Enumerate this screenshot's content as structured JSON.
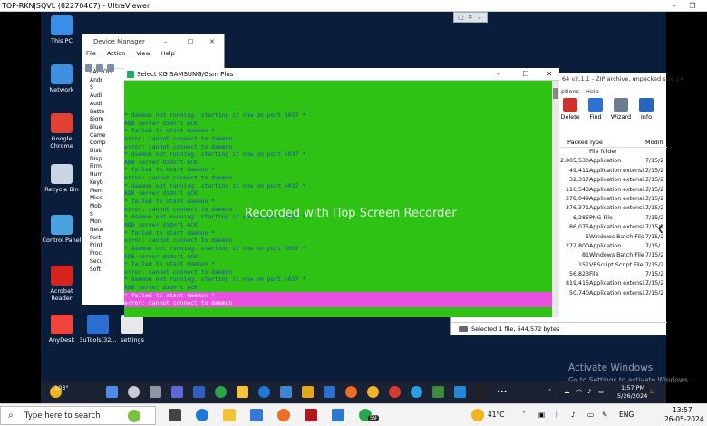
{
  "ultraviewer": {
    "title": "TOP-RKNJSQVL (82270467) - UltraViewer",
    "toolbar_glyphs": "□ ✕ ⌄"
  },
  "desktop_icons": [
    {
      "label": "This PC",
      "color": "#3a8ee6"
    },
    {
      "label": "Network",
      "color": "#3f8fe0"
    },
    {
      "label": "Google Chrome",
      "color": "#e34133"
    },
    {
      "label": "Recycle Bin",
      "color": "#c9d6e3"
    },
    {
      "label": "Control Panel",
      "color": "#4aa3e0"
    },
    {
      "label": "Acrobat Reader",
      "color": "#d6231e"
    },
    {
      "label": "AnyDesk",
      "color": "#ef443b"
    },
    {
      "label": "3uTools(32...",
      "color": "#2d6fd1"
    },
    {
      "label": "settings",
      "color": "#e8e8e8"
    }
  ],
  "device_manager": {
    "title": "Device Manager",
    "menu": [
      "File",
      "Action",
      "View",
      "Help"
    ],
    "tree_root": "LAPTOP-",
    "tree": [
      "Andr",
      "S",
      "Audi",
      "Audi",
      "Batte",
      "Biom",
      "Blue",
      "Came",
      "Comp",
      "Disk",
      "Disp",
      "Firm",
      "Hum",
      "Keyb",
      "Mem",
      "Mice",
      "Mob",
      "S",
      "Mon",
      "Netw",
      "Port",
      "Print",
      "Proc",
      "Secu",
      "Soft"
    ]
  },
  "select_window": {
    "title": "Select KG SAMSUNG/Gsm Plus",
    "console_lines": [
      "* daemon not running. starting it now on port 5037 *",
      "ADB server didn't ACK",
      "* failed to start daemon *",
      "error: cannot connect to daemon",
      "error: cannot connect to daemon",
      "* daemon not running. starting it now on port 5037 *",
      "ADB server didn't ACK",
      "* failed to start daemon *",
      "error: cannot connect to daemon",
      "* daemon not running. starting it now on port 5037 *",
      "ADB server didn't ACK",
      "* failed to start daemon *",
      "error: cannot connect to daemon",
      "* daemon not running. starting it now on port 5037 *",
      "ADB server didn't ACK",
      "* failed to start daemon *",
      "error: cannot connect to daemon",
      "* daemon not running. starting it now on port 5037 *",
      "ADB server didn't ACK",
      "* failed to start daemon *",
      "error: cannot connect to daemon",
      "* daemon not running. starting it now on port 5037 *",
      "ADB server didn't ACK",
      "* failed to start daemon *",
      "error: cannot connect to daemon"
    ],
    "watermark": "Recorded with iTop Screen Recorder"
  },
  "zip_window": {
    "title": "64 v2.1.1 - ZIP archive, unpacked size 14",
    "menu_help": "Help",
    "menu_options": "ptions",
    "tools": [
      {
        "label": "Delete",
        "color": "#d0312d"
      },
      {
        "label": "Find",
        "color": "#2f6fd6"
      },
      {
        "label": "Wizard",
        "color": "#6b7c8c"
      },
      {
        "label": "Info",
        "color": "#2a64c2"
      }
    ],
    "columns": [
      "Packed",
      "Type",
      "Modifi"
    ],
    "rows": [
      {
        "packed": "",
        "type": "File folder",
        "modified": ""
      },
      {
        "packed": "2,805,530",
        "type": "Application",
        "modified": "7/15/2"
      },
      {
        "packed": "49,411",
        "type": "Application extensi...",
        "modified": "7/15/2"
      },
      {
        "packed": "32,317",
        "type": "Application extensi...",
        "modified": "7/15/2"
      },
      {
        "packed": "116,543",
        "type": "Application extensi...",
        "modified": "7/15/2"
      },
      {
        "packed": "278,049",
        "type": "Application extensi...",
        "modified": "7/15/2"
      },
      {
        "packed": "376,371",
        "type": "Application extensi...",
        "modified": "7/15/2"
      },
      {
        "packed": "6,285",
        "type": "PNG File",
        "modified": "7/15/2"
      },
      {
        "packed": "86,075",
        "type": "Application extensi...",
        "modified": "7/15/2"
      },
      {
        "packed": "5",
        "type": "Windows Batch File",
        "modified": "7/15/2"
      },
      {
        "packed": "272,800",
        "type": "Application",
        "modified": "7/15/"
      },
      {
        "packed": "81",
        "type": "Windows Batch File",
        "modified": "7/15/2"
      },
      {
        "packed": "151",
        "type": "VBScript Script File",
        "modified": "7/15/2"
      },
      {
        "packed": "56,823",
        "type": "File",
        "modified": "7/15/2"
      },
      {
        "packed": "819,415",
        "type": "Application extensi...",
        "modified": "7/15/2"
      },
      {
        "packed": "50,740",
        "type": "Application extensi...",
        "modified": "7/15/2"
      }
    ],
    "status": "Selected 1 file, 644,572 bytes"
  },
  "activate": {
    "title": "Activate Windows",
    "sub": "Go to Settings to activate Windows."
  },
  "remote_taskbar": {
    "temp": "103°",
    "time": "1:57 PM",
    "date": "5/26/2024",
    "badge": "59"
  },
  "local_taskbar": {
    "search_placeholder": "Type here to search",
    "weather": "41°C",
    "lang": "ENG",
    "time": "13:57",
    "date": "26-05-2024",
    "badge": "59"
  }
}
